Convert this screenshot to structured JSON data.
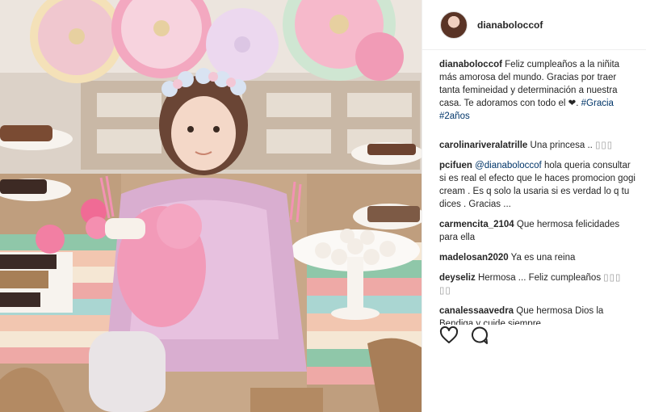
{
  "post": {
    "username": "dianaboloccof",
    "caption": {
      "user": "dianaboloccof",
      "text": "Feliz cumpleaños a la niñita más amorosa del mundo. Gracias por traer tanta femineidad y determinación a nuestra casa. Te adoramos con todo el ❤.",
      "hashtag1": "#Gracia",
      "hashtag2": "#2años"
    },
    "comments": [
      {
        "user": "carolinariveralatrille",
        "text": "Una princesa ..",
        "glyphs": "▯▯▯"
      },
      {
        "user": "pcifuen",
        "mention": "@dianaboloccof",
        "text": "hola queria consultar si es real el efecto que le haces promocion gogi cream . Es q solo la usaria si es verdad lo q tu dices . Gracias ..."
      },
      {
        "user": "carmencita_2104",
        "text": "Que hermosa felicidades para ella"
      },
      {
        "user": "madelosan2020",
        "text": "Ya es una reina"
      },
      {
        "user": "deyseliz",
        "text": "Hermosa ... Feliz cumpleaños",
        "glyphs": "▯▯▯ ▯▯"
      },
      {
        "user": "canalessaavedra",
        "text": "Que hermosa Dios la Bendiga y cuide siempre"
      }
    ]
  },
  "icons": {
    "like": "heart-icon",
    "comment": "comment-bubble-icon"
  },
  "colors": {
    "link": "#003569",
    "text": "#262626",
    "border": "#efefef"
  }
}
